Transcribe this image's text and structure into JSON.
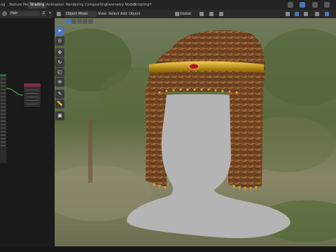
{
  "topbar": {
    "tabs": [
      {
        "label": "ng",
        "active": false
      },
      {
        "label": "Texture Paint",
        "active": false
      },
      {
        "label": "Shading",
        "active": true
      },
      {
        "label": "Animation",
        "active": false
      },
      {
        "label": "Rendering",
        "active": false
      },
      {
        "label": "Compositing",
        "active": false
      },
      {
        "label": "Geometry Nodes",
        "active": false
      },
      {
        "label": "Scripting",
        "active": false
      }
    ],
    "add_tab": "+"
  },
  "node_editor": {
    "material_name": "Hair",
    "user_count": "2"
  },
  "viewport_header": {
    "mode": "Object Mode",
    "menus": [
      "View",
      "Select",
      "Add",
      "Object"
    ],
    "pivot": "Global"
  },
  "toolbar": {
    "tools": [
      "select-box",
      "cursor",
      "move",
      "rotate",
      "scale",
      "transform",
      "annotate",
      "measure",
      "add-cube"
    ]
  },
  "colors": {
    "active_tab": "#3d3d3d",
    "accent": "#4a77b9",
    "hair": "#7a4a26",
    "headband_gold": "#c9a227",
    "headband_gem": "#b3142a",
    "head_placeholder": "#b4b4b4"
  }
}
